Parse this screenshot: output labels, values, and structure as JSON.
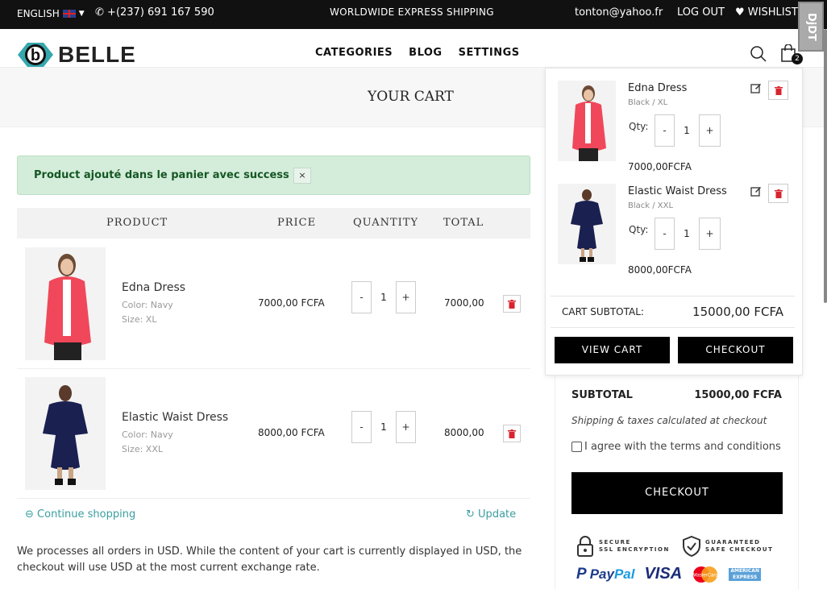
{
  "topbar": {
    "language": "ENGLISH",
    "phone": "+(237) 691 167 590",
    "shipping_banner": "WORLDWIDE EXPRESS SHIPPING",
    "email": "tonton@yahoo.fr",
    "logout": "LOG OUT",
    "wishlist": "WISHLIST",
    "corner_badge": "DjDT"
  },
  "header": {
    "brand": "BELLE",
    "nav": [
      "CATEGORIES",
      "BLOG",
      "SETTINGS"
    ],
    "cart_count": "2"
  },
  "page": {
    "title": "YOUR CART",
    "alert": "Product ajouté dans le panier avec success !",
    "alert_close": "×"
  },
  "table": {
    "headers": {
      "product": "PRODUCT",
      "price": "PRICE",
      "quantity": "QUANTITY",
      "total": "TOTAL"
    },
    "rows": [
      {
        "name": "Edna Dress",
        "color": "Color: Navy",
        "size": "Size: XL",
        "price": "7000,00 FCFA",
        "qty": "1",
        "total": "7000,00"
      },
      {
        "name": "Elastic Waist Dress",
        "color": "Color: Navy",
        "size": "Size: XXL",
        "price": "8000,00 FCFA",
        "qty": "1",
        "total": "8000,00"
      }
    ],
    "minus": "-",
    "plus": "+"
  },
  "actions": {
    "continue": "Continue shopping",
    "update": "Update"
  },
  "note": "We processes all orders in USD. While the content of your cart is currently displayed in USD, the checkout will use USD at the most current exchange rate.",
  "summary": {
    "subtotal_label": "SUBTOTAL",
    "subtotal_value": "15000,00 FCFA",
    "shipping_note": "Shipping & taxes calculated at checkout",
    "agree": "I agree with the terms and conditions",
    "checkout": "CHECKOUT",
    "secure_1": "SECURE",
    "secure_2": "SSL ENCRYPTION",
    "safe_1": "GUARANTEED",
    "safe_2": "SAFE CHECKOUT",
    "paypal_1": "Pay",
    "paypal_2": "Pal",
    "visa": "VISA",
    "mastercard": "MasterCard",
    "amex_1": "AMERICAN",
    "amex_2": "EXPRESS"
  },
  "minicart": {
    "items": [
      {
        "name": "Edna Dress",
        "variant": "Black / XL",
        "qty_label": "Qty:",
        "qty": "1",
        "price": "7000,00FCFA"
      },
      {
        "name": "Elastic Waist Dress",
        "variant": "Black / XXL",
        "qty_label": "Qty:",
        "qty": "1",
        "price": "8000,00FCFA"
      }
    ],
    "subtotal_label": "CART SUBTOTAL:",
    "subtotal_value": "15000,00 FCFA",
    "view_cart": "VIEW CART",
    "checkout": "CHECKOUT"
  },
  "colors": {
    "accent_teal": "#3a9ea0",
    "alert_bg": "#d4edda",
    "alert_text": "#155724",
    "trash_red": "#d9232d",
    "topbar": "#111111"
  }
}
